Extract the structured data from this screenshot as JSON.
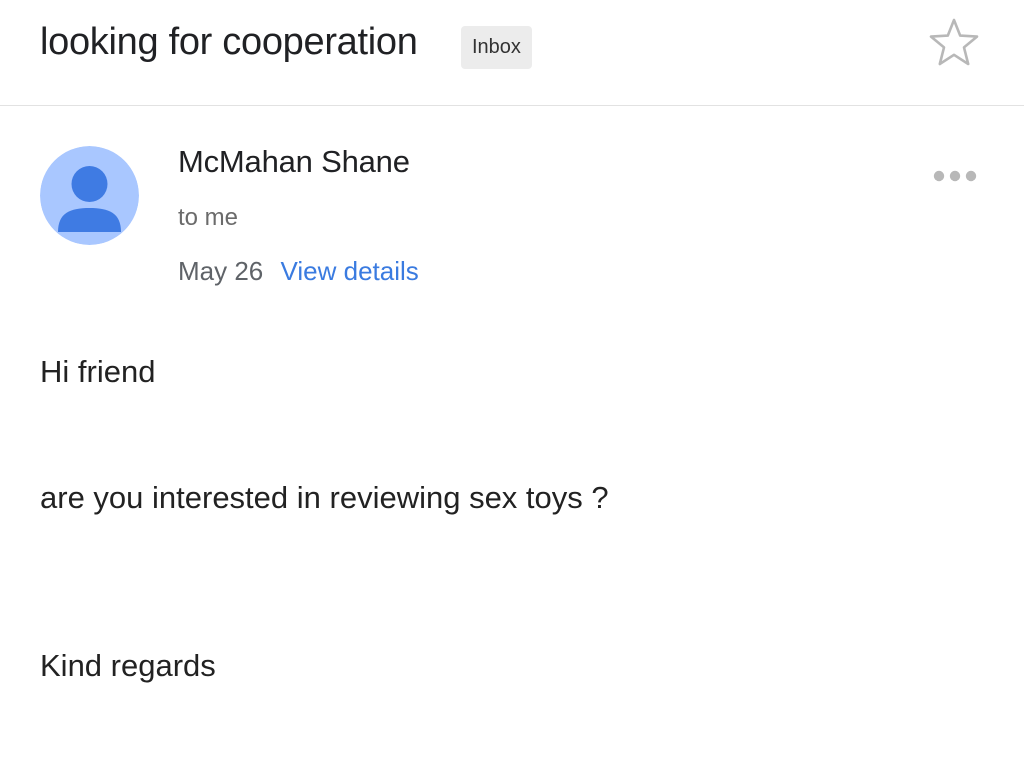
{
  "email": {
    "subject": "looking for cooperation",
    "label": "Inbox",
    "starred": false,
    "star_icon": "star-outline-icon",
    "more_icon": "more-horizontal-icon",
    "avatar_icon": "person-icon",
    "sender_name": "McMahan Shane",
    "recipient": "to me",
    "date": "May 26",
    "details_link": "View details",
    "body_lines": [
      "Hi friend",
      "are you interested in reviewing sex toys ?",
      "Kind regards"
    ]
  },
  "colors": {
    "avatar_background": "#a9c7ff",
    "avatar_figure": "#3f7be3",
    "link": "#3a7be0",
    "chip_background": "#ececec",
    "icon_gray": "#b8b8b8"
  }
}
